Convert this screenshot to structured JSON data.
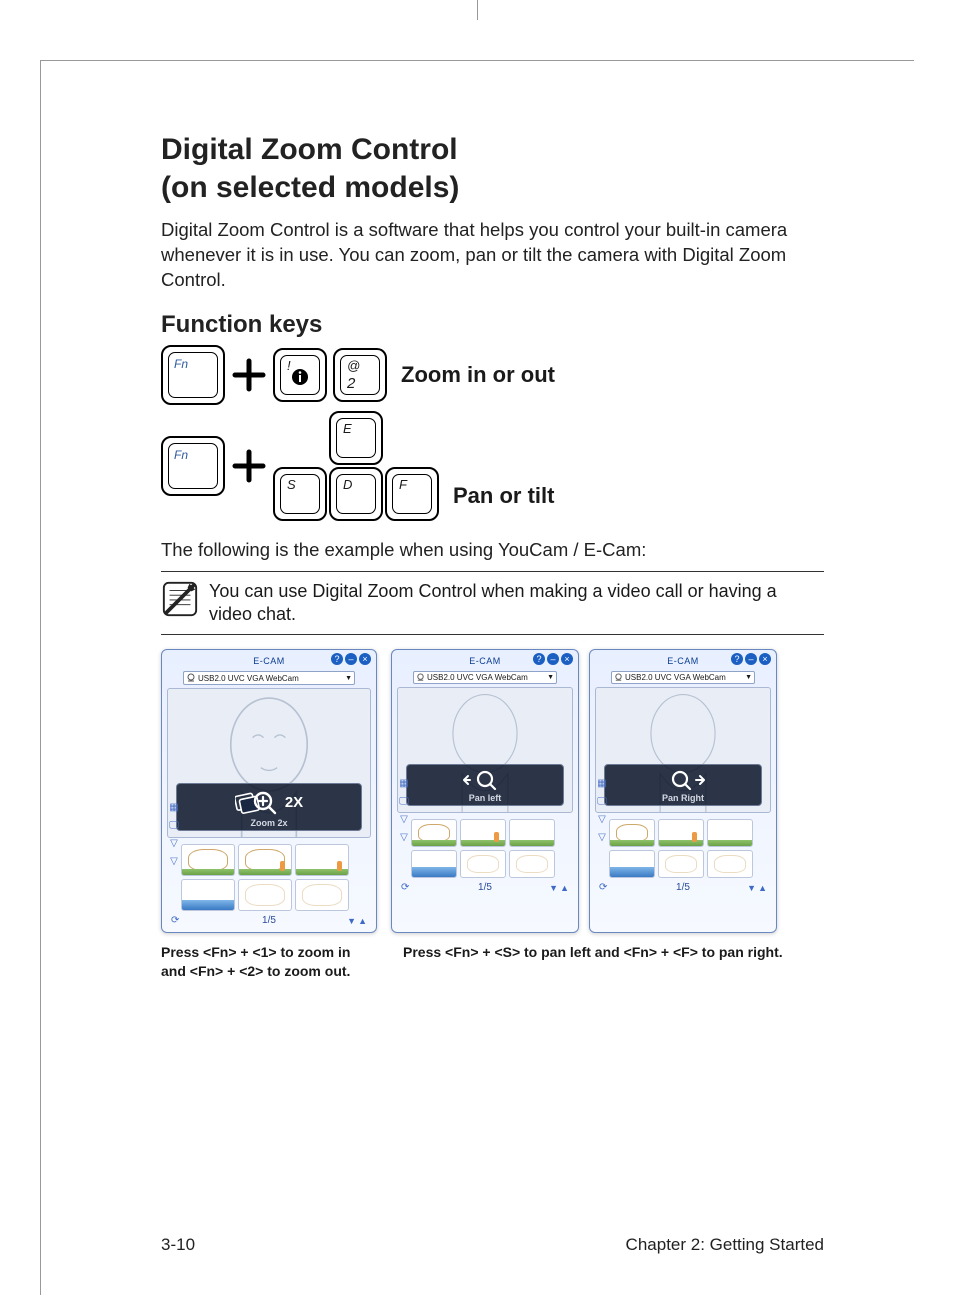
{
  "title_line1": "Digital Zoom Control",
  "title_line2": "(on selected models)",
  "intro": "Digital Zoom Control is a software that helps you control your built-in camera whenever it is in use. You can zoom, pan or tilt the camera with Digital Zoom Control.",
  "section_fk": "Function keys",
  "fn_label": "Fn",
  "key_exclaim": "!",
  "key_at": "@",
  "key_2": "2",
  "row1_label": "Zoom in or out",
  "key_E": "E",
  "key_S": "S",
  "key_D": "D",
  "key_F": "F",
  "row2_label": "Pan or tilt",
  "example_text": "The following is the example when using YouCam / E-Cam:",
  "note_text": "You can use Digital Zoom Control when making a video call or having a video chat.",
  "ecam_title": "E-CAM",
  "cam_name": "USB2.0 UVC VGA WebCam",
  "overlay_2x": "2X",
  "overlay_zoom_label": "Zoom 2x",
  "overlay_panleft_label": "Pan left",
  "overlay_panright_label": "Pan Right",
  "pager": "1/5",
  "caption1": "Press <Fn> + <1> to zoom in and <Fn> + <2> to zoom out.",
  "caption2": "Press <Fn> + <S> to pan left and <Fn> + <F> to pan right.",
  "footer_page": "3-10",
  "footer_chapter": "Chapter 2: Getting Started"
}
